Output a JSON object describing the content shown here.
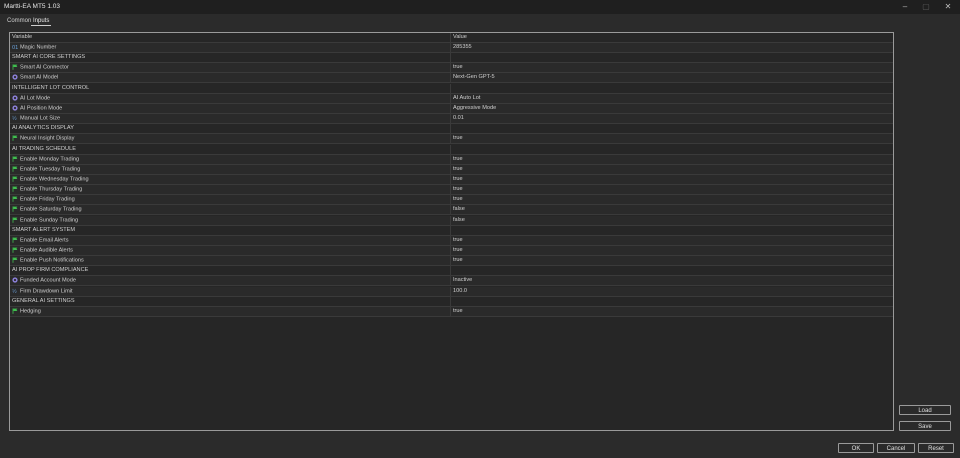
{
  "window": {
    "title": "Martti-EA MT5 1.03"
  },
  "tabs": [
    {
      "label": "Common"
    },
    {
      "label": "Inputs"
    }
  ],
  "table": {
    "headers": {
      "variable": "Variable",
      "value": "Value"
    },
    "rows": [
      {
        "type": "param",
        "icon": "number-icon",
        "name": "Magic Number",
        "value": "285355"
      },
      {
        "type": "section",
        "name": "SMART AI CORE SETTINGS",
        "value": ""
      },
      {
        "type": "param",
        "icon": "flag-icon",
        "name": "Smart AI Connector",
        "value": "true"
      },
      {
        "type": "param",
        "icon": "enum-icon",
        "name": "Smart AI Model",
        "value": "Next-Gen GPT-5"
      },
      {
        "type": "section",
        "name": "INTELLIGENT LOT CONTROL",
        "value": ""
      },
      {
        "type": "param",
        "icon": "enum-icon",
        "name": "AI Lot Mode",
        "value": "AI Auto Lot"
      },
      {
        "type": "param",
        "icon": "enum-icon",
        "name": "AI Position Mode",
        "value": "Aggressive Mode"
      },
      {
        "type": "param",
        "icon": "fraction-icon",
        "name": "Manual Lot Size",
        "value": "0.01"
      },
      {
        "type": "section",
        "name": "AI ANALYTICS DISPLAY",
        "value": ""
      },
      {
        "type": "param",
        "icon": "flag-icon",
        "name": "Neural Insight Display",
        "value": "true"
      },
      {
        "type": "section",
        "name": "AI TRADING SCHEDULE",
        "value": ""
      },
      {
        "type": "param",
        "icon": "flag-icon",
        "name": "Enable Monday Trading",
        "value": "true"
      },
      {
        "type": "param",
        "icon": "flag-icon",
        "name": "Enable Tuesday Trading",
        "value": "true"
      },
      {
        "type": "param",
        "icon": "flag-icon",
        "name": "Enable Wednesday Trading",
        "value": "true"
      },
      {
        "type": "param",
        "icon": "flag-icon",
        "name": "Enable Thursday Trading",
        "value": "true"
      },
      {
        "type": "param",
        "icon": "flag-icon",
        "name": "Enable Friday Trading",
        "value": "true"
      },
      {
        "type": "param",
        "icon": "flag-icon",
        "name": "Enable Saturday Trading",
        "value": "false"
      },
      {
        "type": "param",
        "icon": "flag-icon",
        "name": "Enable Sunday Trading",
        "value": "false"
      },
      {
        "type": "section",
        "name": "SMART ALERT SYSTEM",
        "value": ""
      },
      {
        "type": "param",
        "icon": "flag-icon",
        "name": "Enable Email Alerts",
        "value": "true"
      },
      {
        "type": "param",
        "icon": "flag-icon",
        "name": "Enable Audible Alerts",
        "value": "true"
      },
      {
        "type": "param",
        "icon": "flag-icon",
        "name": "Enable Push Notifications",
        "value": "true"
      },
      {
        "type": "section",
        "name": "AI PROP FIRM COMPLIANCE",
        "value": ""
      },
      {
        "type": "param",
        "icon": "enum-icon",
        "name": "Funded Account Mode",
        "value": "Inactive"
      },
      {
        "type": "param",
        "icon": "fraction-icon",
        "name": "Firm Drawdown Limit",
        "value": "100.0"
      },
      {
        "type": "section",
        "name": "GENERAL AI SETTINGS",
        "value": ""
      },
      {
        "type": "param",
        "icon": "flag-icon",
        "name": "Hedging",
        "value": "true"
      }
    ]
  },
  "side_buttons": {
    "load": "Load",
    "save": "Save"
  },
  "footer_buttons": {
    "ok": "OK",
    "cancel": "Cancel",
    "reset": "Reset"
  },
  "colors": {
    "background": "#2b2b2b",
    "titlebar": "#1f1f1f",
    "grid_border": "#9a9a9a",
    "flag_icon": "#3fbf4f",
    "enum_icon": "#8b7fd6",
    "number_icon": "#6aa0d8"
  }
}
